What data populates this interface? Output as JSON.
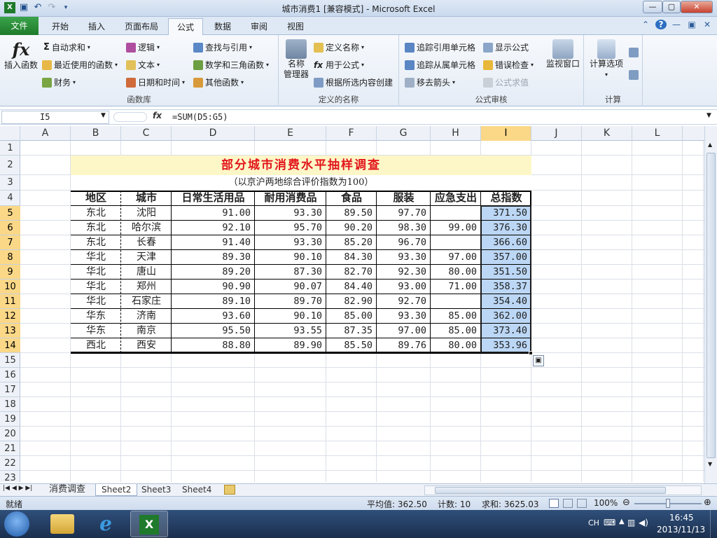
{
  "window": {
    "title": "城市消费1 [兼容模式] - Microsoft Excel",
    "min_label": "—",
    "max_label": "▢",
    "close_label": "✕"
  },
  "tabs": [
    "文件",
    "开始",
    "插入",
    "页面布局",
    "公式",
    "数据",
    "审阅",
    "视图"
  ],
  "active_tab": "公式",
  "ribbon": {
    "insert_function": "插入函数",
    "autosum": "自动求和",
    "recent": "最近使用的函数",
    "finance": "财务",
    "logic": "逻辑",
    "text": "文本",
    "datetime": "日期和时间",
    "lookup": "查找与引用",
    "math": "数学和三角函数",
    "other": "其他函数",
    "group_library": "函数库",
    "name_manager_1": "名称",
    "name_manager_2": "管理器",
    "define_name": "定义名称",
    "use_in_formula": "用于公式",
    "create_from_selection": "根据所选内容创建",
    "group_names": "定义的名称",
    "trace_precedents": "追踪引用单元格",
    "trace_dependents": "追踪从属单元格",
    "remove_arrows": "移去箭头",
    "show_formulas": "显示公式",
    "error_checking": "错误检查",
    "evaluate_formula": "公式求值",
    "watch_window": "监视窗口",
    "group_audit": "公式审核",
    "calc_options": "计算选项",
    "group_calc": "计算"
  },
  "formula_bar": {
    "name_box": "I5",
    "fx": "fx",
    "formula": "=SUM(D5:G5)"
  },
  "columns": [
    "A",
    "B",
    "C",
    "D",
    "E",
    "F",
    "G",
    "H",
    "I",
    "J",
    "K",
    "L"
  ],
  "selected_column": "I",
  "rows": [
    "1",
    "2",
    "3",
    "4",
    "5",
    "6",
    "7",
    "8",
    "9",
    "10",
    "11",
    "12",
    "13",
    "14",
    "15",
    "16",
    "17",
    "18",
    "19",
    "20",
    "21",
    "22",
    "23"
  ],
  "selected_rows": [
    "5",
    "6",
    "7",
    "8",
    "9",
    "10",
    "11",
    "12",
    "13",
    "14"
  ],
  "sheet": {
    "title": "部分城市消费水平抽样调查",
    "subtitle": "（以京沪两地综合评价指数为100）",
    "headers": [
      "地区",
      "城市",
      "日常生活用品",
      "耐用消费品",
      "食品",
      "服装",
      "应急支出",
      "总指数"
    ],
    "data": [
      [
        "东北",
        "沈阳",
        "91.00",
        "93.30",
        "89.50",
        "97.70",
        "",
        "371.50"
      ],
      [
        "东北",
        "哈尔滨",
        "92.10",
        "95.70",
        "90.20",
        "98.30",
        "99.00",
        "376.30"
      ],
      [
        "东北",
        "长春",
        "91.40",
        "93.30",
        "85.20",
        "96.70",
        "",
        "366.60"
      ],
      [
        "华北",
        "天津",
        "89.30",
        "90.10",
        "84.30",
        "93.30",
        "97.00",
        "357.00"
      ],
      [
        "华北",
        "唐山",
        "89.20",
        "87.30",
        "82.70",
        "92.30",
        "80.00",
        "351.50"
      ],
      [
        "华北",
        "郑州",
        "90.90",
        "90.07",
        "84.40",
        "93.00",
        "71.00",
        "358.37"
      ],
      [
        "华北",
        "石家庄",
        "89.10",
        "89.70",
        "82.90",
        "92.70",
        "",
        "354.40"
      ],
      [
        "华东",
        "济南",
        "93.60",
        "90.10",
        "85.00",
        "93.30",
        "85.00",
        "362.00"
      ],
      [
        "华东",
        "南京",
        "95.50",
        "93.55",
        "87.35",
        "97.00",
        "85.00",
        "373.40"
      ],
      [
        "西北",
        "西安",
        "88.80",
        "89.90",
        "85.50",
        "89.76",
        "80.00",
        "353.96"
      ]
    ]
  },
  "sheet_tabs": [
    "消费调查",
    "Sheet2",
    "Sheet3",
    "Sheet4"
  ],
  "active_sheet": "Sheet2",
  "status": {
    "ready": "就绪",
    "average": "平均值: 362.50",
    "count": "计数: 10",
    "sum": "求和: 3625.03",
    "zoom": "100%"
  },
  "taskbar": {
    "lang": "CH",
    "time": "16:45",
    "date": "2013/11/13"
  }
}
